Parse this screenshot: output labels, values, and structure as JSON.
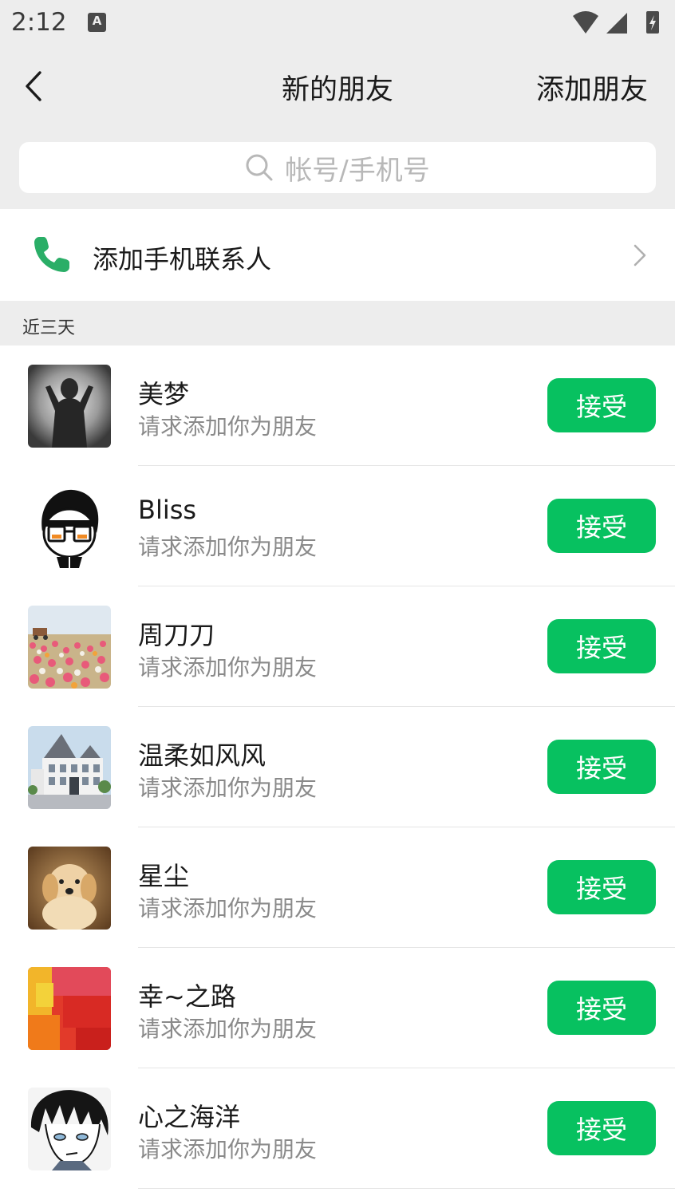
{
  "status_bar": {
    "time": "2:12",
    "a_badge": "A"
  },
  "nav": {
    "title": "新的朋友",
    "add_friend": "添加朋友"
  },
  "search": {
    "placeholder": "帐号/手机号"
  },
  "phone_contacts": {
    "label": "添加手机联系人"
  },
  "section": {
    "label": "近三天"
  },
  "colors": {
    "accent": "#07c160",
    "background": "#ededed",
    "text": "#1a1a1a",
    "subtext": "#8a8a8a"
  },
  "requests": [
    {
      "name": "美梦",
      "subtitle": "请求添加你为朋友",
      "accept": "接受"
    },
    {
      "name": "Bliss",
      "subtitle": "请求添加你为朋友",
      "accept": "接受"
    },
    {
      "name": "周刀刀",
      "subtitle": "请求添加你为朋友",
      "accept": "接受"
    },
    {
      "name": "温柔如风风",
      "subtitle": "请求添加你为朋友",
      "accept": "接受"
    },
    {
      "name": "星尘",
      "subtitle": "请求添加你为朋友",
      "accept": "接受"
    },
    {
      "name": "幸~之路",
      "subtitle": "请求添加你为朋友",
      "accept": "接受"
    },
    {
      "name": "心之海洋",
      "subtitle": "请求添加你为朋友",
      "accept": "接受"
    }
  ]
}
